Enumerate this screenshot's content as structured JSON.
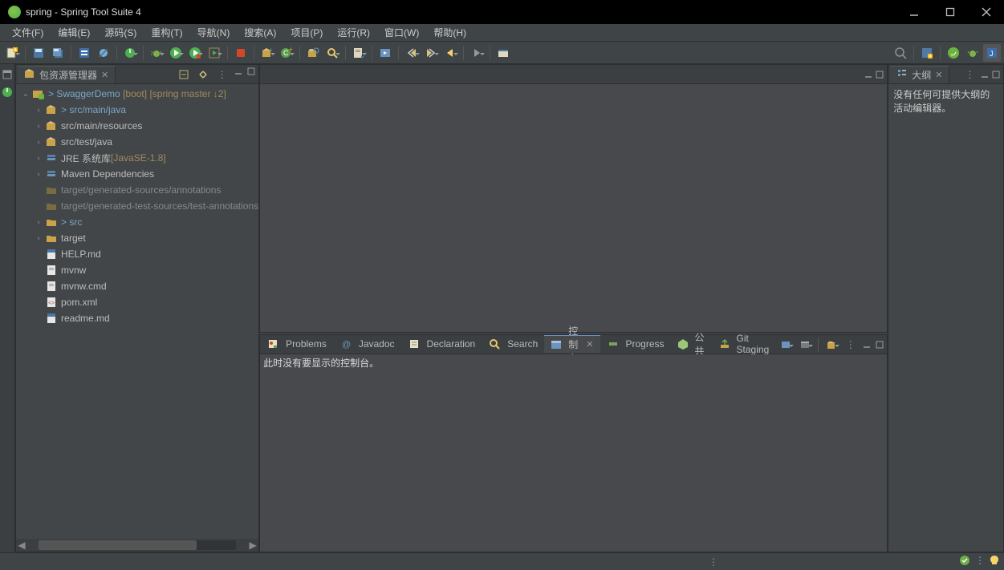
{
  "window": {
    "title": "spring - Spring Tool Suite 4"
  },
  "menu": [
    "文件(F)",
    "编辑(E)",
    "源码(S)",
    "重构(T)",
    "导航(N)",
    "搜索(A)",
    "项目(P)",
    "运行(R)",
    "窗口(W)",
    "帮助(H)"
  ],
  "pkgExplorer": {
    "title": "包资源管理器",
    "project": {
      "prefix": ">",
      "name": "SwaggerDemo",
      "extra": "[boot]",
      "branch": "[spring master ↓2]"
    },
    "children": [
      {
        "kind": "pkg",
        "arrow": "›",
        "prefix": ">",
        "label": "src/main/java",
        "link": true
      },
      {
        "kind": "pkg",
        "arrow": "›",
        "prefix": "",
        "label": "src/main/resources",
        "link": false
      },
      {
        "kind": "pkg",
        "arrow": "›",
        "prefix": "",
        "label": "src/test/java",
        "link": false
      },
      {
        "kind": "lib",
        "arrow": "›",
        "prefix": "",
        "label": "JRE 系统库",
        "suffix": "[JavaSE-1.8]",
        "link": false
      },
      {
        "kind": "lib",
        "arrow": "›",
        "prefix": "",
        "label": "Maven Dependencies",
        "link": false
      },
      {
        "kind": "vfolder",
        "arrow": "",
        "prefix": "",
        "label": "target/generated-sources/annotations",
        "dim": true
      },
      {
        "kind": "vfolder",
        "arrow": "",
        "prefix": "",
        "label": "target/generated-test-sources/test-annotations",
        "dim": true
      },
      {
        "kind": "folder",
        "arrow": "›",
        "prefix": ">",
        "label": "src",
        "link": true
      },
      {
        "kind": "folder",
        "arrow": "›",
        "prefix": "",
        "label": "target",
        "link": false
      },
      {
        "kind": "file-md",
        "arrow": "",
        "prefix": "",
        "label": "HELP.md"
      },
      {
        "kind": "file",
        "arrow": "",
        "prefix": "",
        "label": "mvnw"
      },
      {
        "kind": "file",
        "arrow": "",
        "prefix": "",
        "label": "mvnw.cmd"
      },
      {
        "kind": "file-xml",
        "arrow": "",
        "prefix": "",
        "label": "pom.xml"
      },
      {
        "kind": "file-md",
        "arrow": "",
        "prefix": "",
        "label": "readme.md"
      }
    ]
  },
  "outline": {
    "title": "大纲",
    "message": "没有任何可提供大纲的活动编辑器。"
  },
  "bottomTabs": [
    "Problems",
    "Javadoc",
    "Declaration",
    "Search",
    "控制台",
    "Progress",
    "公共",
    "Git Staging"
  ],
  "bottomActiveIndex": 4,
  "console": {
    "message": "此时没有要显示的控制台。"
  }
}
